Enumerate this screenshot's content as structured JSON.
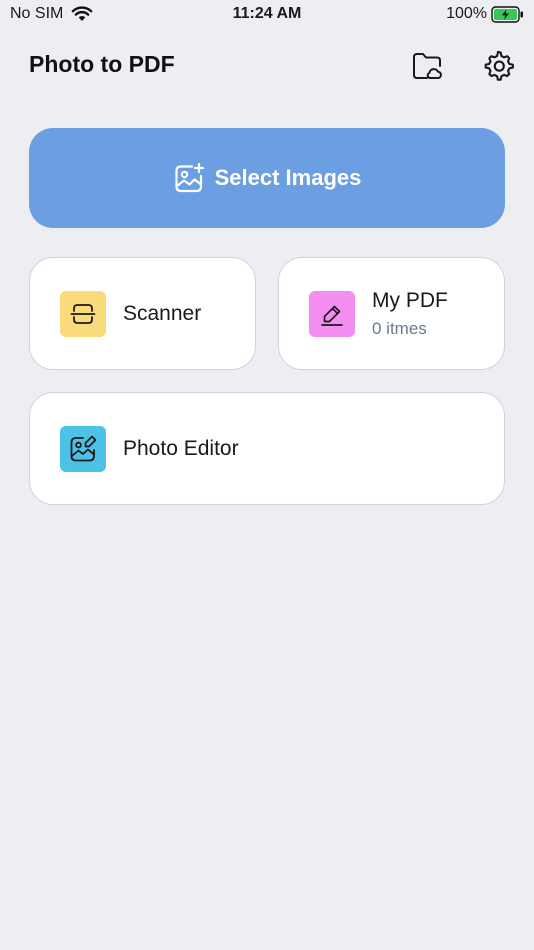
{
  "status_bar": {
    "carrier": "No SIM",
    "time": "11:24 AM",
    "battery": "100%"
  },
  "header": {
    "title": "Photo to PDF"
  },
  "select_images": {
    "label": "Select Images",
    "color": "#6B9FE2"
  },
  "cards": {
    "scanner": {
      "label": "Scanner",
      "icon": "scanner-icon",
      "icon_bg": "#FADB7C"
    },
    "my_pdf": {
      "label": "My PDF",
      "count": "0 itmes",
      "icon": "pen-icon",
      "icon_bg": "#F48EF0"
    },
    "photo_editor": {
      "label": "Photo Editor",
      "icon": "image-edit-icon",
      "icon_bg": "#4CC3E6"
    }
  },
  "icons": {
    "wifi": "wifi-icon",
    "battery": "battery-charging-icon",
    "folder": "folder-cloud-icon",
    "settings": "gear-icon",
    "image_add": "image-add-icon"
  }
}
